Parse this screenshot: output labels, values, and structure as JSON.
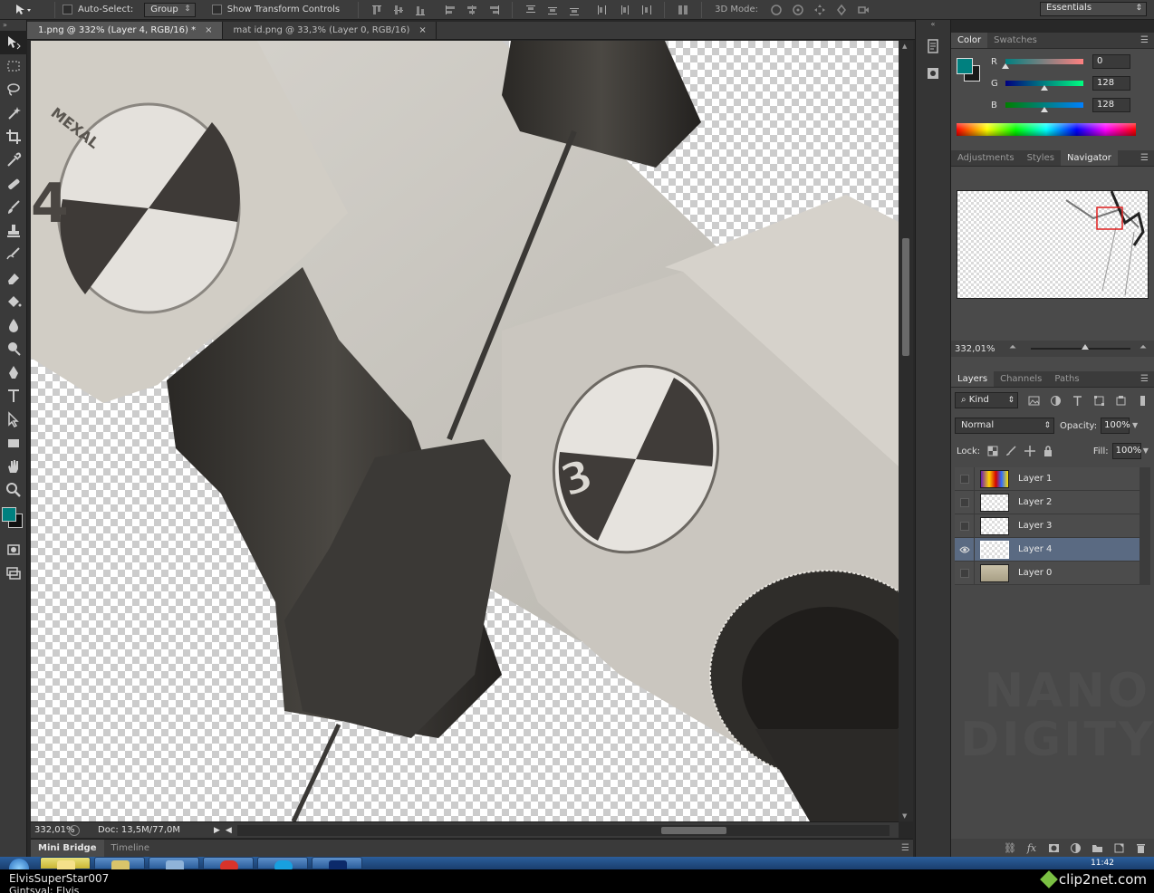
{
  "options_bar": {
    "auto_select_label": "Auto-Select:",
    "auto_select_mode": "Group",
    "transform_controls_label": "Show Transform Controls",
    "three_d_mode_label": "3D Mode:",
    "workspace": "Essentials"
  },
  "document_tabs": [
    {
      "label": "1.png @ 332% (Layer 4, RGB/16) *",
      "close": "×",
      "active": true
    },
    {
      "label": "mat id.png @ 33,3% (Layer 0, RGB/16)",
      "close": "×",
      "active": false
    }
  ],
  "canvas": {
    "marker_number": "3",
    "marker_text": "MEXAL",
    "marker_number_left": "4"
  },
  "status_bar": {
    "zoom": "332,01%",
    "doc_info": "Doc: 13,5M/77,0M"
  },
  "bottom_panel": {
    "tabs": [
      "Mini Bridge",
      "Timeline"
    ]
  },
  "color_panel": {
    "tabs": [
      "Color",
      "Swatches"
    ],
    "foreground": "#00807f",
    "background": "#1a1a1a",
    "channels": [
      {
        "label": "R",
        "value": "0",
        "fraction": 0.0
      },
      {
        "label": "G",
        "value": "128",
        "fraction": 0.502
      },
      {
        "label": "B",
        "value": "128",
        "fraction": 0.502
      }
    ]
  },
  "navigator_panel": {
    "tabs": [
      "Adjustments",
      "Styles",
      "Navigator"
    ],
    "zoom": "332,01%"
  },
  "layers_panel": {
    "tabs": [
      "Layers",
      "Channels",
      "Paths"
    ],
    "kind_label": "Kind",
    "blend_mode": "Normal",
    "opacity_label": "Opacity:",
    "opacity": "100%",
    "lock_label": "Lock:",
    "fill_label": "Fill:",
    "fill": "100%",
    "layers": [
      {
        "name": "Layer 1",
        "visible": false,
        "selected": false,
        "thumb": "colorful"
      },
      {
        "name": "Layer 2",
        "visible": false,
        "selected": false,
        "thumb": "transparent"
      },
      {
        "name": "Layer 3",
        "visible": false,
        "selected": false,
        "thumb": "transparent"
      },
      {
        "name": "Layer 4",
        "visible": true,
        "selected": true,
        "thumb": "transparent"
      },
      {
        "name": "Layer 0",
        "visible": false,
        "selected": false,
        "thumb": "stone"
      }
    ],
    "watermark_lines": [
      "NANO",
      "DIGITY"
    ]
  },
  "taskbar": {
    "time": "11:42"
  },
  "caption": {
    "username": "ElvisSuperStar007",
    "realname": "Gintsval: Elvis",
    "brand": "clip2net.com"
  },
  "colors": {
    "accent_teal": "#00807f",
    "selected_layer": "#5a6a82",
    "panel_bg": "#484848"
  }
}
